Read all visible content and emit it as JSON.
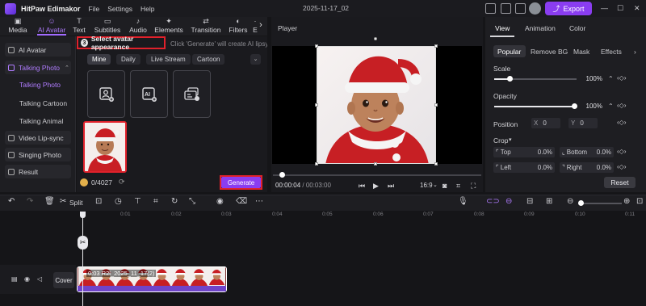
{
  "app": {
    "name": "HitPaw Edimakor",
    "menus": [
      "File",
      "Settings",
      "Help"
    ],
    "doc_title": "2025-11-17_02",
    "export_label": "Export",
    "win_controls": [
      "—",
      "☐",
      "✕"
    ]
  },
  "tabs": [
    {
      "label": "Media",
      "icon": "media-icon"
    },
    {
      "label": "AI Avatar",
      "icon": "ai-avatar-icon"
    },
    {
      "label": "Text",
      "icon": "text-icon"
    },
    {
      "label": "Subtitles",
      "icon": "subtitles-icon"
    },
    {
      "label": "Audio",
      "icon": "audio-icon"
    },
    {
      "label": "Elements",
      "icon": "elements-icon"
    },
    {
      "label": "Transition",
      "icon": "transition-icon"
    },
    {
      "label": "Filters",
      "icon": "filters-icon"
    },
    {
      "label": "E",
      "icon": "effects-icon"
    }
  ],
  "sidebar": {
    "items": [
      {
        "label": "AI Avatar"
      },
      {
        "label": "Talking Photo"
      },
      {
        "label": "Talking Photo"
      },
      {
        "label": "Talking Cartoon"
      },
      {
        "label": "Talking Animal"
      },
      {
        "label": "Video Lip-sync"
      },
      {
        "label": "Singing Photo"
      },
      {
        "label": "Result"
      }
    ]
  },
  "avatar_panel": {
    "step_number": "3",
    "heading": "Select avatar appearance",
    "hint": "Click 'Generate' will create AI lipsync...",
    "chips": [
      "Mine",
      "Daily",
      "Live Stream",
      "Cartoon"
    ],
    "chip_more": "⌄",
    "credits": "0/4027",
    "generate_label": "Generate"
  },
  "player": {
    "label": "Player",
    "time_current": "00:00:04",
    "time_sep": " / ",
    "time_total": "00:03:00",
    "ratio": "16:9",
    "progress_fraction": 0.03
  },
  "right_panel": {
    "tabs": [
      "View",
      "Animation",
      "Color"
    ],
    "subtabs": [
      "Popular",
      "Remove BG",
      "Mask",
      "Effects"
    ],
    "scale_label": "Scale",
    "scale_value": "100%",
    "opacity_label": "Opacity",
    "opacity_value": "100%",
    "position_label": "Position",
    "pos_x_label": "X",
    "pos_x_value": "0",
    "pos_y_label": "Y",
    "pos_y_value": "0",
    "crop_label": "Crop",
    "crop_top_label": "Top",
    "crop_top_value": "0.0%",
    "crop_bottom_label": "Bottom",
    "crop_bottom_value": "0.0%",
    "crop_left_label": "Left",
    "crop_left_value": "0.0%",
    "crop_right_label": "Right",
    "crop_right_value": "0.0%",
    "reset_label": "Reset"
  },
  "timeline": {
    "split_label": "Split",
    "ruler_ticks": [
      "0:01",
      "0:02",
      "0:03",
      "0:04",
      "0:05",
      "0:06",
      "0:07",
      "0:08",
      "0:09",
      "0:10",
      "0:11"
    ],
    "cover_label": "Cover",
    "clip_label": "0:03 R2l_2025_11_17(2)"
  },
  "colors": {
    "accent": "#8a3df0",
    "highlight_box": "#e0212b",
    "active_text": "#b07cff"
  }
}
